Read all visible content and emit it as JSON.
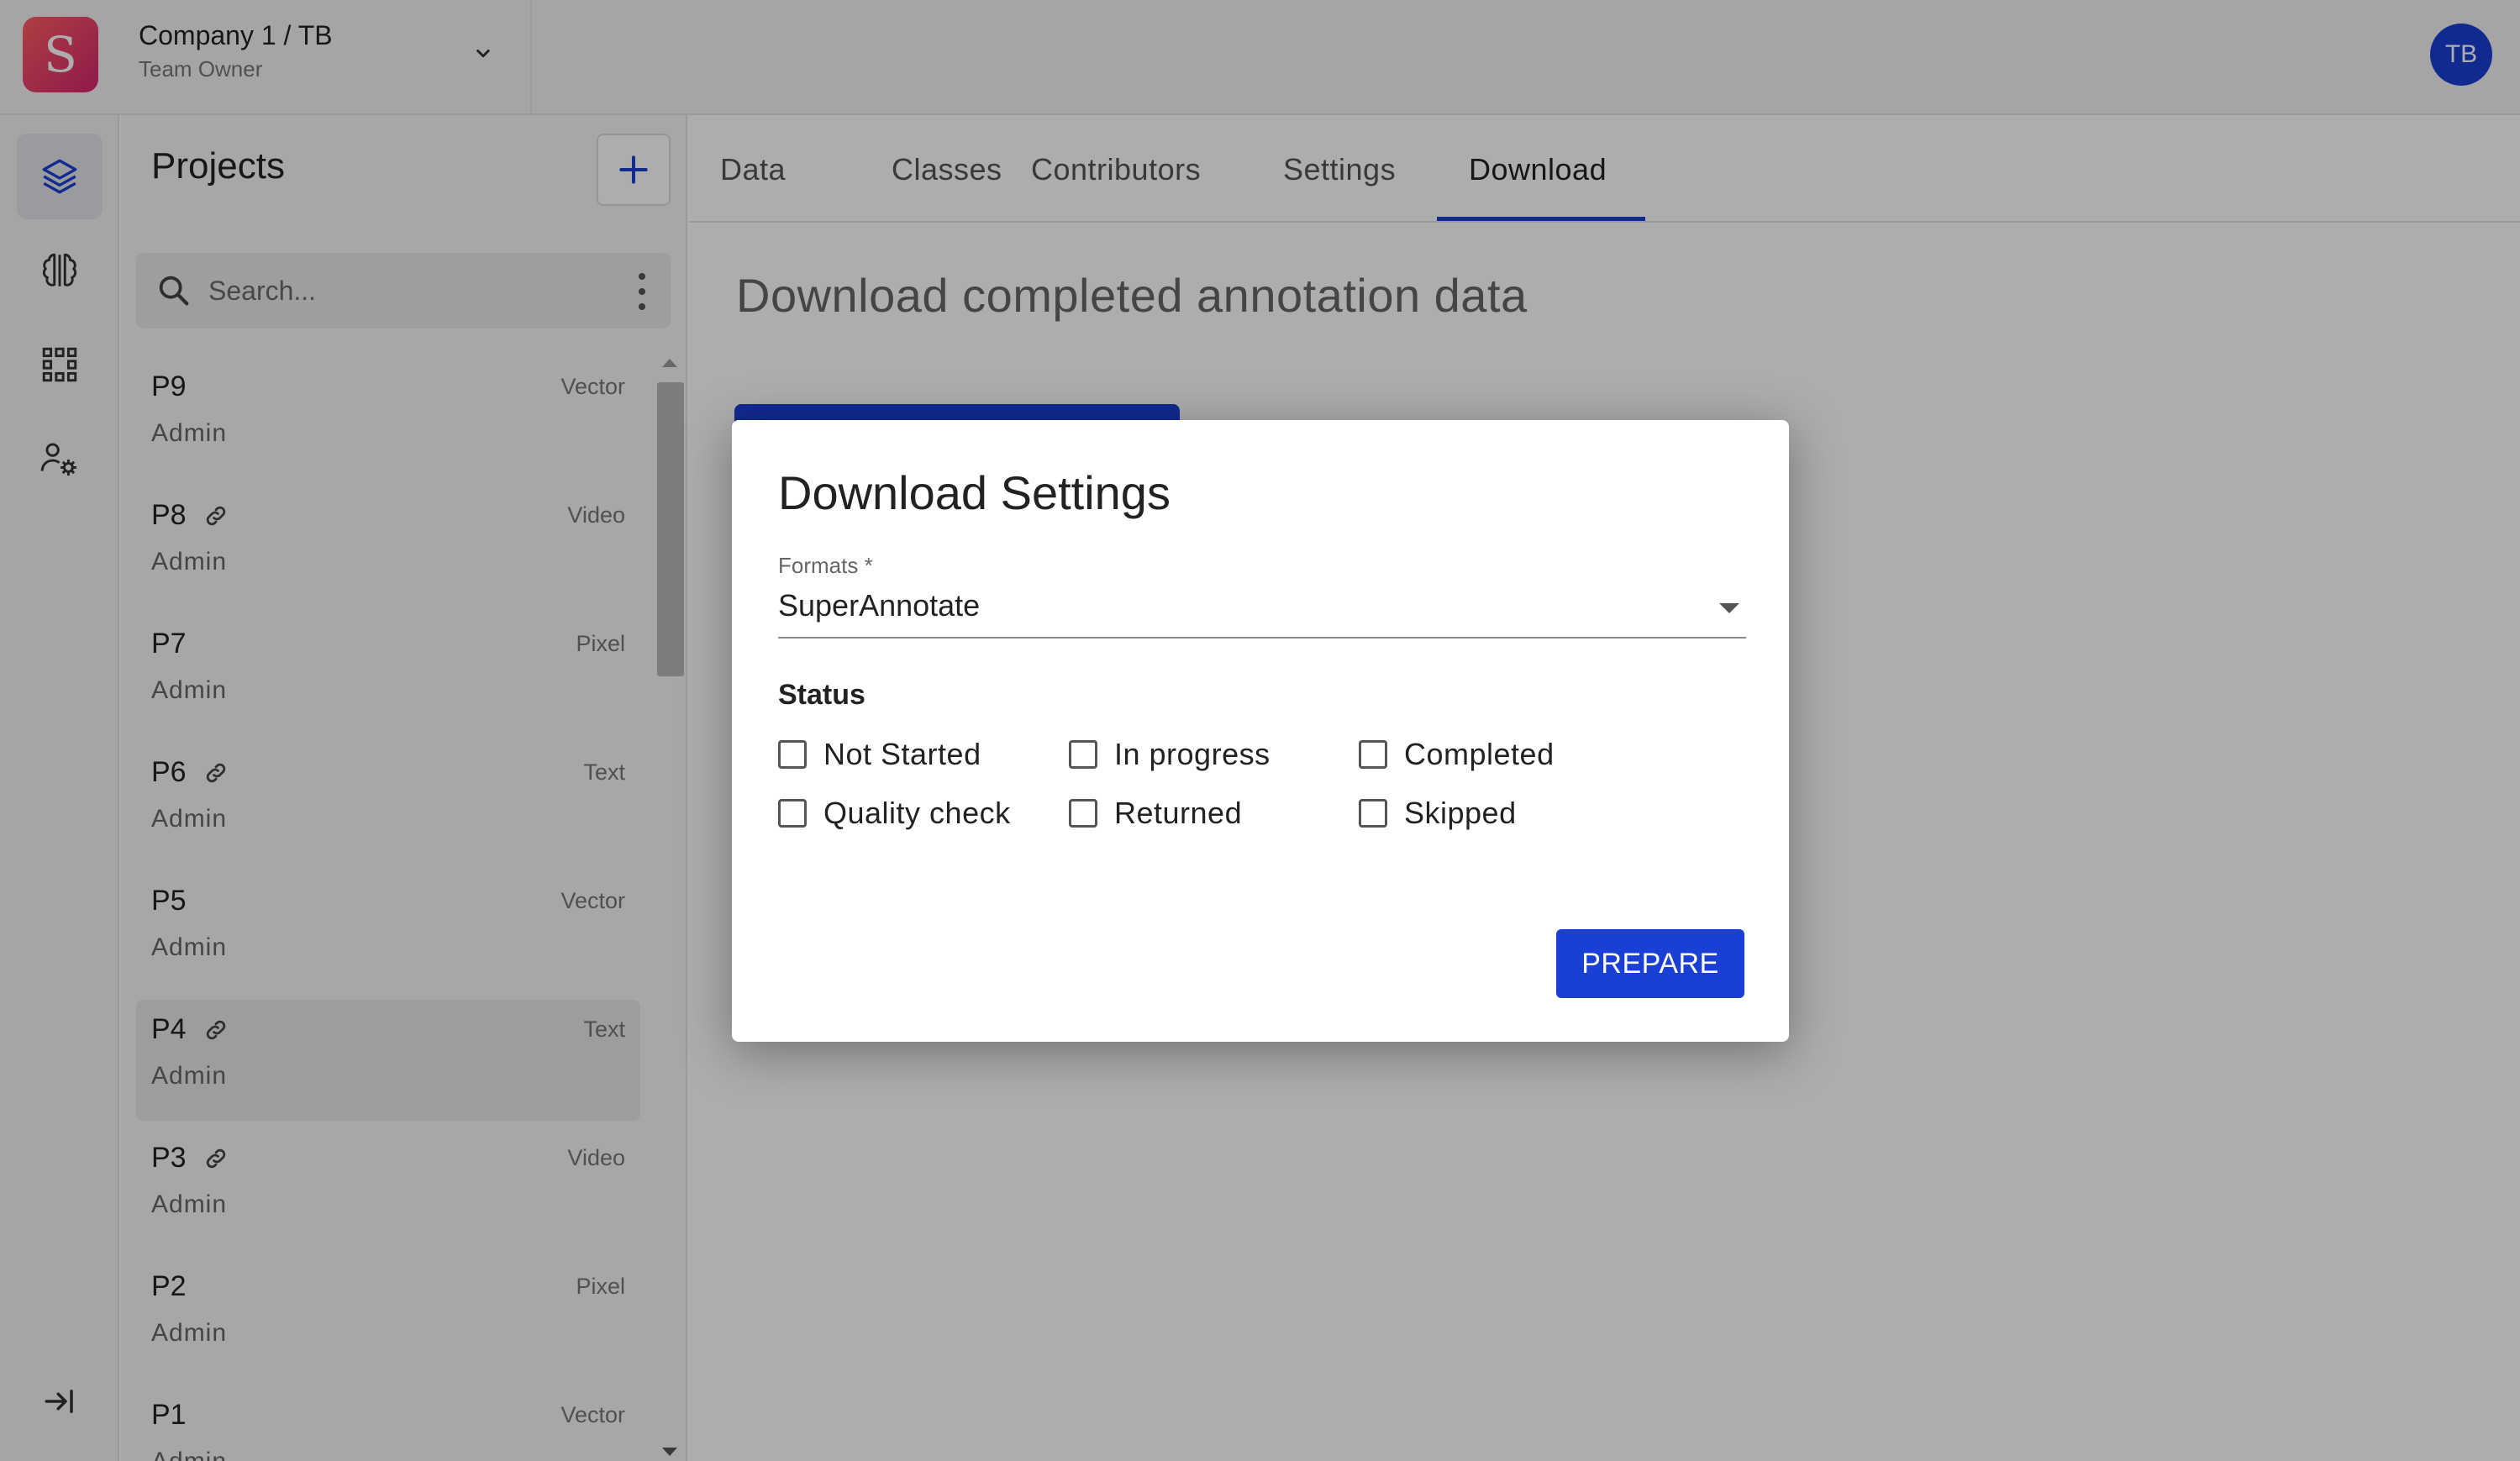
{
  "header": {
    "logo_letter": "S",
    "company_name": "Company 1 / TB",
    "company_role": "Team Owner",
    "avatar_initials": "TB"
  },
  "rail": {
    "items": [
      {
        "icon": "layers-icon",
        "active": true
      },
      {
        "icon": "brain-icon",
        "active": false
      },
      {
        "icon": "grid-icon",
        "active": false
      },
      {
        "icon": "team-settings-icon",
        "active": false
      }
    ],
    "collapse_icon": "collapse-sidebar-icon"
  },
  "projects": {
    "title": "Projects",
    "search_placeholder": "Search...",
    "items": [
      {
        "name": "P9",
        "type": "Vector",
        "owner": "Admin",
        "linked": false,
        "selected": false
      },
      {
        "name": "P8",
        "type": "Video",
        "owner": "Admin",
        "linked": true,
        "selected": false
      },
      {
        "name": "P7",
        "type": "Pixel",
        "owner": "Admin",
        "linked": false,
        "selected": false
      },
      {
        "name": "P6",
        "type": "Text",
        "owner": "Admin",
        "linked": true,
        "selected": false
      },
      {
        "name": "P5",
        "type": "Vector",
        "owner": "Admin",
        "linked": false,
        "selected": false
      },
      {
        "name": "P4",
        "type": "Text",
        "owner": "Admin",
        "linked": true,
        "selected": true
      },
      {
        "name": "P3",
        "type": "Video",
        "owner": "Admin",
        "linked": true,
        "selected": false
      },
      {
        "name": "P2",
        "type": "Pixel",
        "owner": "Admin",
        "linked": false,
        "selected": false
      },
      {
        "name": "P1",
        "type": "Vector",
        "owner": "Admin",
        "linked": false,
        "selected": false
      }
    ]
  },
  "tabs": [
    {
      "label": "Data"
    },
    {
      "label": "Classes"
    },
    {
      "label": "Contributors"
    },
    {
      "label": "Settings"
    },
    {
      "label": "Download",
      "active": true
    }
  ],
  "page": {
    "heading": "Download completed annotation data"
  },
  "modal": {
    "title": "Download Settings",
    "formats_label": "Formats *",
    "formats_value": "SuperAnnotate",
    "status_heading": "Status",
    "statuses": [
      {
        "label": "Not Started",
        "checked": false
      },
      {
        "label": "In progress",
        "checked": false
      },
      {
        "label": "Completed",
        "checked": false
      },
      {
        "label": "Quality check",
        "checked": false
      },
      {
        "label": "Returned",
        "checked": false
      },
      {
        "label": "Skipped",
        "checked": false
      }
    ],
    "prepare_label": "PREPARE"
  },
  "colors": {
    "accent": "#1a3fd4",
    "overlay": "rgba(0,0,0,0.32)"
  }
}
